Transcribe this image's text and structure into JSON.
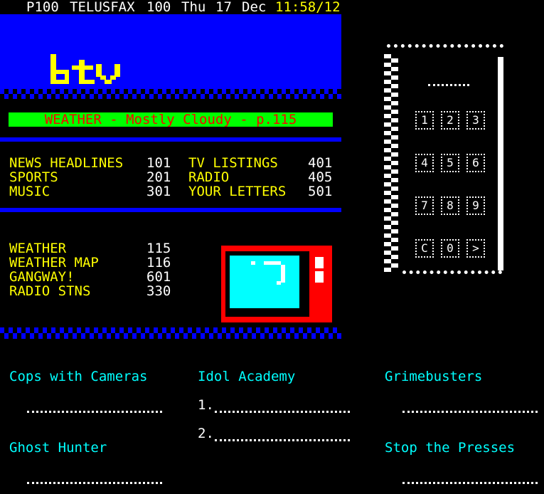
{
  "header": {
    "page": "P100",
    "service": "TELUSFAX",
    "number": "100",
    "day": "Thu",
    "date": "17",
    "month": "Dec",
    "clock": "11:58/12"
  },
  "logo": {
    "text": "btv"
  },
  "weather_banner": "WEATHER - Mostly Cloudy - p.115",
  "index_left": [
    {
      "label": "NEWS HEADLINES",
      "page": "101"
    },
    {
      "label": "SPORTS",
      "page": "201"
    },
    {
      "label": "MUSIC",
      "page": "301"
    }
  ],
  "index_right": [
    {
      "label": "TV LISTINGS",
      "page": "401"
    },
    {
      "label": "RADIO",
      "page": "405"
    },
    {
      "label": "YOUR LETTERS",
      "page": "501"
    }
  ],
  "quick_links": [
    {
      "label": "WEATHER",
      "page": "115"
    },
    {
      "label": "WEATHER MAP",
      "page": "116"
    },
    {
      "label": "GANGWAY!",
      "page": "601"
    },
    {
      "label": "RADIO STNS",
      "page": "330"
    }
  ],
  "remote": {
    "keys": [
      "1",
      "2",
      "3",
      "4",
      "5",
      "6",
      "7",
      "8",
      "9",
      "C",
      "0",
      ">"
    ]
  },
  "shows": {
    "cops": "Cops with Cameras",
    "idol": "Idol Academy",
    "grime": "Grimebusters",
    "ghost": "Ghost Hunter",
    "presses": "Stop the Presses",
    "entry1": "1.",
    "entry2": "2."
  },
  "colors": {
    "background": "#000000",
    "panel_blue": "#0000ff",
    "banner_green": "#00ff00",
    "text_yellow": "#ffff00",
    "text_cyan": "#00ffff",
    "text_red": "#ff0000",
    "tv_red": "#ff0000",
    "screen_cyan": "#00ffff"
  }
}
